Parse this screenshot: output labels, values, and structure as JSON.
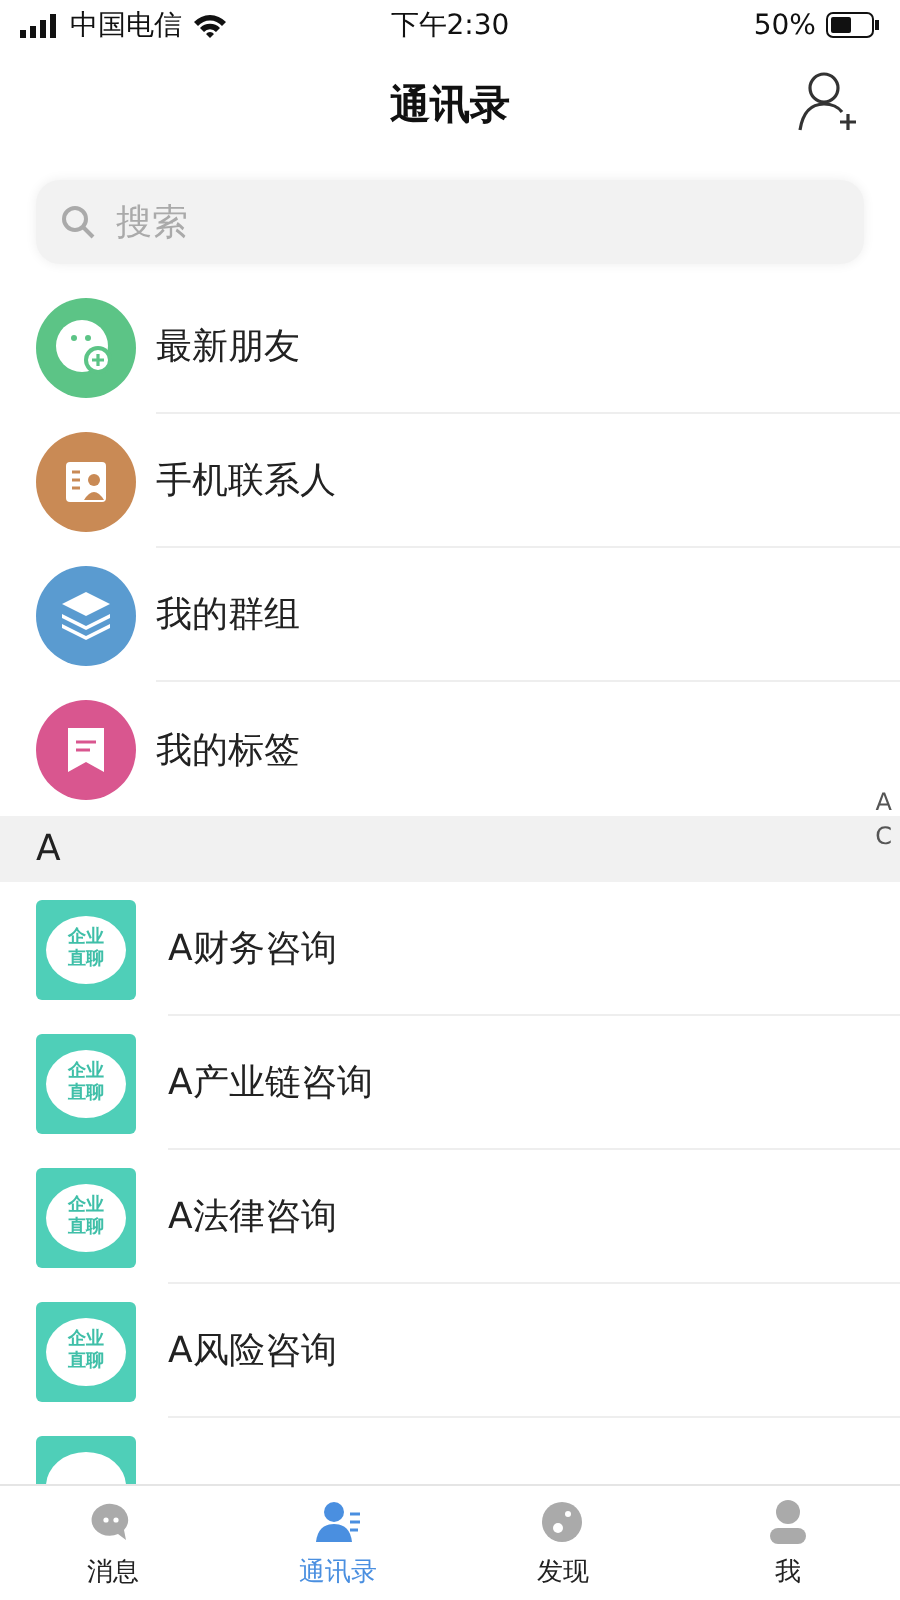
{
  "status_bar": {
    "carrier": "中国电信",
    "time": "下午2:30",
    "battery": "50%"
  },
  "header": {
    "title": "通讯录"
  },
  "search": {
    "placeholder": "搜索"
  },
  "shortcuts": [
    {
      "label": "最新朋友",
      "kind": "friends",
      "color": "#5cc486"
    },
    {
      "label": "手机联系人",
      "kind": "contacts",
      "color": "#c98a55"
    },
    {
      "label": "我的群组",
      "kind": "groups",
      "color": "#5a9bd0"
    },
    {
      "label": "我的标签",
      "kind": "tags",
      "color": "#d9568f"
    }
  ],
  "index_letters": [
    "A",
    "C"
  ],
  "section": {
    "letter": "A",
    "contacts": [
      {
        "name": "A财务咨询",
        "logo": [
          "企业",
          "直聊"
        ]
      },
      {
        "name": "A产业链咨询",
        "logo": [
          "企业",
          "直聊"
        ]
      },
      {
        "name": "A法律咨询",
        "logo": [
          "企业",
          "直聊"
        ]
      },
      {
        "name": "A风险咨询",
        "logo": [
          "企业",
          "直聊"
        ]
      },
      {
        "kind": "partial"
      }
    ]
  },
  "tabs": [
    {
      "label": "消息",
      "kind": "chat",
      "selected": false
    },
    {
      "label": "通讯录",
      "kind": "contacts",
      "selected": true
    },
    {
      "label": "发现",
      "kind": "discover",
      "selected": false
    },
    {
      "label": "我",
      "kind": "me",
      "selected": false
    }
  ]
}
